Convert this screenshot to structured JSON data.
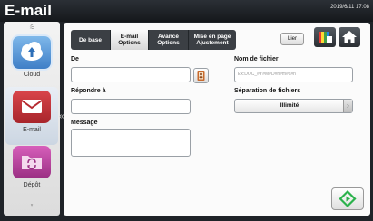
{
  "header": {
    "title": "E-mail",
    "datetime": "2019/6/11 17:08"
  },
  "rail": {
    "items": [
      {
        "label": "Cloud",
        "icon": "cloud-upload-icon"
      },
      {
        "label": "E-mail",
        "icon": "envelope-icon"
      },
      {
        "label": "Dépôt",
        "icon": "folder-sync-icon"
      }
    ],
    "selected": "E-mail"
  },
  "tabs": [
    {
      "label": "De base"
    },
    {
      "label": "E-mail Options",
      "active": true
    },
    {
      "label": "Avancé Options"
    },
    {
      "label": "Mise en page Ajustement"
    }
  ],
  "toolbar": {
    "link_label": "Lier",
    "color_icon": "color-palette-icon",
    "home_icon": "home-icon"
  },
  "form": {
    "from_label": "De",
    "from_value": "",
    "reply_label": "Répondre à",
    "reply_value": "",
    "message_label": "Message",
    "message_value": "",
    "filename_label": "Nom de fichier",
    "filename_placeholder": "Ex:DOC_#Y#M#D#h#m#s#n",
    "separation_label": "Séparation de fichiers",
    "separation_value": "Illimité"
  },
  "colors": {
    "accent_green": "#2bb24c",
    "tile_cloud": "#4a8fd6",
    "tile_email": "#c33339",
    "tile_depot": "#c14aa5"
  }
}
